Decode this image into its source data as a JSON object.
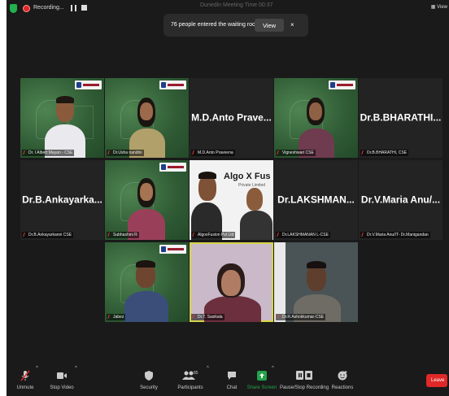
{
  "topbar": {
    "recording_label": "Recording...",
    "meeting_title": "Dunedin Meeting Time 00:37",
    "view_label": "View"
  },
  "waiting_popup": {
    "message": "76 people entered the waiting room",
    "view_button": "View",
    "close": "×"
  },
  "tiles": [
    {
      "name": "Dr. I Albert Mayan - CSE"
    },
    {
      "name": "Dr.Usha nandini"
    },
    {
      "name": "M.D.Anto Praveena",
      "big": "M.D.Anto  Prave..."
    },
    {
      "name": "Vigneshwari CSE"
    },
    {
      "name": "Dr.B.BHARATHI, CSE",
      "big": "Dr.B.BHARATHI..."
    },
    {
      "name": "Dr.B.Ankayarkanni CSE",
      "big": "Dr.B.Ankayarka..."
    },
    {
      "name": "Subhashini R"
    },
    {
      "name": "AlgoxFusion Pvt Ltd",
      "banner": "Algo X Fus",
      "banner_sub": "Private Limited"
    },
    {
      "name": "Dr.LAKSHMANAN L-CSE",
      "big": "Dr.LAKSHMAN..."
    },
    {
      "name": "Dr.V.Maria Anu/IT- Dr.Manigandan",
      "big": "Dr.V.Maria  Anu/..."
    },
    {
      "name": "Jabez"
    },
    {
      "name": "Dr.T. Sasikala"
    },
    {
      "name": "Dr.R.Ashokkumar-CSE"
    }
  ],
  "toolbar": {
    "unmute": "Unmute",
    "stop_video": "Stop Video",
    "security": "Security",
    "participants": "Participants",
    "participants_count": "85",
    "chat": "Chat",
    "share_screen": "Share Screen",
    "record": "Pause/Stop Recording",
    "reactions": "Reactions",
    "leave": "Leave"
  },
  "colors": {
    "leave_red": "#e02828",
    "share_green": "#23a34b",
    "active_border": "#d8d44a",
    "recording_red": "#e02828"
  }
}
